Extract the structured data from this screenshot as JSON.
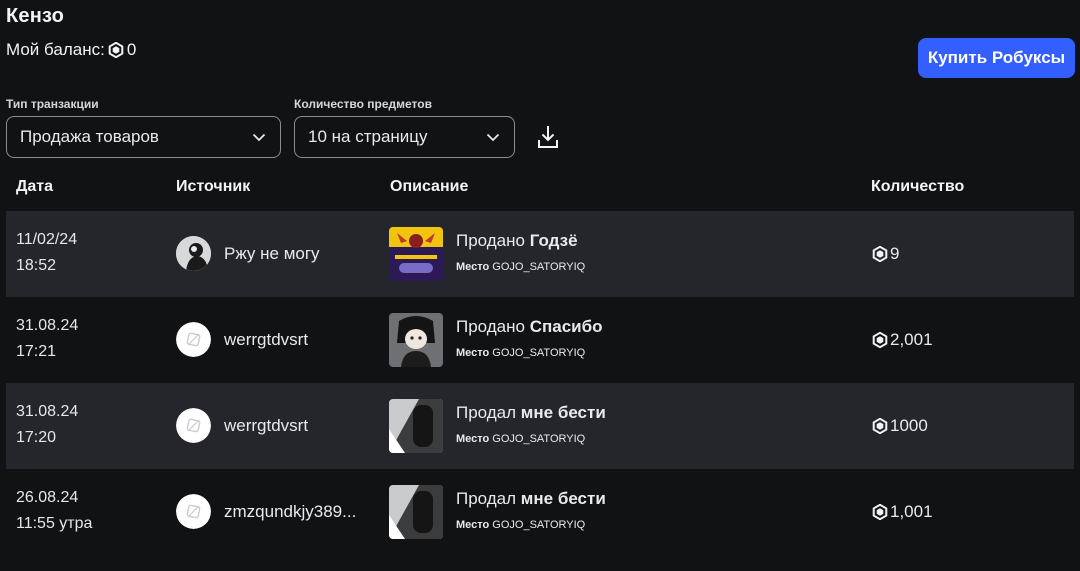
{
  "header": {
    "title": "Кензо",
    "balance_label": "Мой баланс:",
    "balance_value": "0",
    "buy_button": "Купить Робуксы"
  },
  "filters": {
    "transaction_type_label": "Тип транзакции",
    "transaction_type_value": "Продажа товаров",
    "items_count_label": "Количество предметов",
    "items_count_value": "10 на страницу"
  },
  "table": {
    "columns": [
      "Дата",
      "Источник",
      "Описание",
      "Количество"
    ],
    "rows": [
      {
        "date": "11/02/24",
        "time": "18:52",
        "source": "Ржу не могу",
        "action": "Продано",
        "item": "Годзё",
        "place_label": "Место",
        "place": "GOJO_SATORYIQ",
        "amount": "9"
      },
      {
        "date": "31.08.24",
        "time": "17:21",
        "source": "werrgtdvsrt",
        "action": "Продано",
        "item": "Спасибо",
        "place_label": "Место",
        "place": "GOJO_SATORYIQ",
        "amount": "2,001"
      },
      {
        "date": "31.08.24",
        "time": "17:20",
        "source": "werrgtdvsrt",
        "action": "Продал",
        "item": "мне бести",
        "place_label": "Место",
        "place": "GOJO_SATORYIQ",
        "amount": "1000"
      },
      {
        "date": "26.08.24",
        "time": "11:55 утра",
        "source": "zmzqundkjy389...",
        "action": "Продал",
        "item": "мне бести",
        "place_label": "Место",
        "place": "GOJO_SATORYIQ",
        "amount": "1,001"
      }
    ]
  },
  "colors": {
    "accent": "#335fff",
    "background": "#111214",
    "row_shaded": "#24262c"
  },
  "icons": [
    "robux-icon",
    "chevron-down-icon",
    "download-icon"
  ]
}
